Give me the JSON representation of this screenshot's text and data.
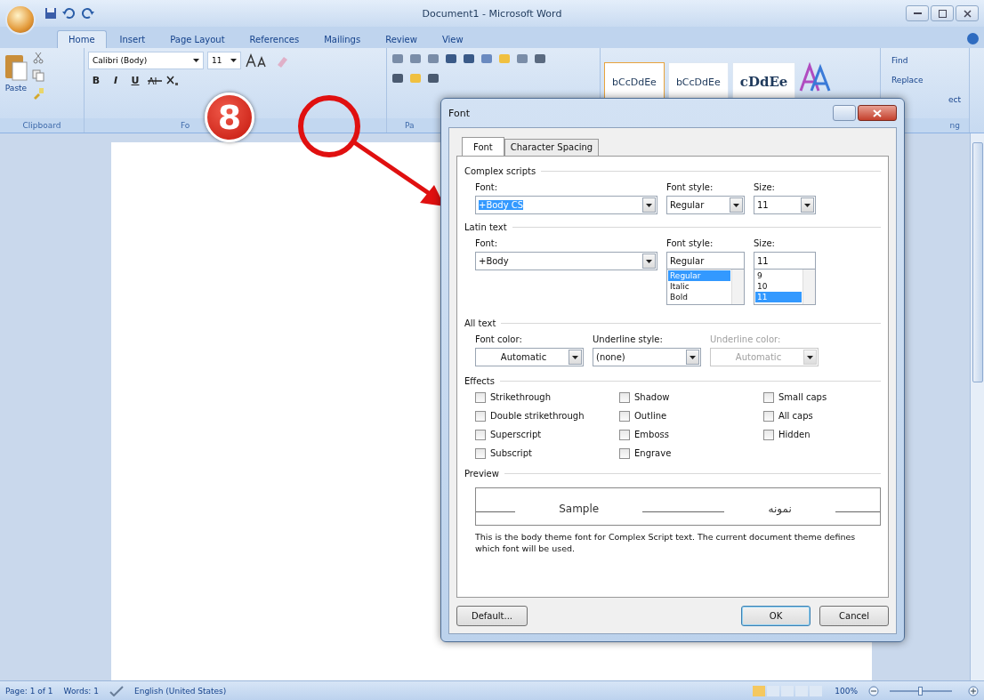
{
  "window": {
    "title": "Document1 - Microsoft Word"
  },
  "ribbon_tabs": [
    {
      "label": "Home",
      "selected": true
    },
    {
      "label": "Insert",
      "selected": false
    },
    {
      "label": "Page Layout",
      "selected": false
    },
    {
      "label": "References",
      "selected": false
    },
    {
      "label": "Mailings",
      "selected": false
    },
    {
      "label": "Review",
      "selected": false
    },
    {
      "label": "View",
      "selected": false
    }
  ],
  "ribbon": {
    "paste_label": "Paste",
    "font_name": "Calibri (Body)",
    "font_size": "11",
    "format_buttons": [
      "B",
      "I",
      "U"
    ],
    "styles": [
      {
        "label": "bCcDdEe",
        "selected": true
      },
      {
        "label": "bCcDdEe",
        "selected": false
      },
      {
        "label": "cDdEe",
        "selected": false
      }
    ],
    "editing": [
      "Find",
      "Replace",
      "ect"
    ],
    "group_labels": [
      "Clipboard",
      "Fo",
      "Pa",
      "ng"
    ]
  },
  "annotation": {
    "step": "8"
  },
  "font_dialog": {
    "title": "Font",
    "tabs": [
      {
        "label": "Font",
        "selected": true
      },
      {
        "label": "Character Spacing",
        "selected": false
      }
    ],
    "complex_scripts": {
      "heading": "Complex scripts",
      "font_label": "Font:",
      "font_value": "+Body CS",
      "style_label": "Font style:",
      "style_value": "Regular",
      "size_label": "Size:",
      "size_value": "11"
    },
    "latin_text": {
      "heading": "Latin text",
      "font_label": "Font:",
      "font_value": "+Body",
      "style_label": "Font style:",
      "style_value": "Regular",
      "size_label": "Size:",
      "size_value": "11",
      "style_options": [
        {
          "label": "Regular",
          "selected": true
        },
        {
          "label": "Italic",
          "selected": false
        },
        {
          "label": "Bold",
          "selected": false
        }
      ],
      "size_options": [
        {
          "label": "9",
          "selected": false
        },
        {
          "label": "10",
          "selected": false
        },
        {
          "label": "11",
          "selected": true
        }
      ]
    },
    "all_text": {
      "heading": "All text",
      "fields": [
        {
          "label": "Font color:",
          "value": "Automatic",
          "disabled": false
        },
        {
          "label": "Underline style:",
          "value": "(none)",
          "disabled": false
        },
        {
          "label": "Underline color:",
          "value": "Automatic",
          "disabled": true
        }
      ]
    },
    "effects": {
      "heading": "Effects",
      "columns": [
        [
          {
            "label": "Strikethrough",
            "checked": false
          },
          {
            "label": "Double strikethrough",
            "checked": false
          },
          {
            "label": "Superscript",
            "checked": false
          },
          {
            "label": "Subscript",
            "checked": false
          }
        ],
        [
          {
            "label": "Shadow",
            "checked": false
          },
          {
            "label": "Outline",
            "checked": false
          },
          {
            "label": "Emboss",
            "checked": false
          },
          {
            "label": "Engrave",
            "checked": false
          }
        ],
        [
          {
            "label": "Small caps",
            "checked": false
          },
          {
            "label": "All caps",
            "checked": false
          },
          {
            "label": "Hidden",
            "checked": false
          }
        ]
      ]
    },
    "preview": {
      "heading": "Preview",
      "sample": "Sample",
      "sample_complex": "نمونه",
      "note": "This is the body theme font for Complex Script text. The current document theme defines which font will be used."
    },
    "buttons": [
      {
        "label": "Default...",
        "kind": "default"
      },
      {
        "label": "OK",
        "kind": "ok"
      },
      {
        "label": "Cancel",
        "kind": "cancel"
      }
    ]
  },
  "status_bar": {
    "page": "Page: 1 of 1",
    "words": "Words: 1",
    "language": "English (United States)",
    "zoom": "100%",
    "zoom_slider": {
      "level": 0.5
    }
  }
}
